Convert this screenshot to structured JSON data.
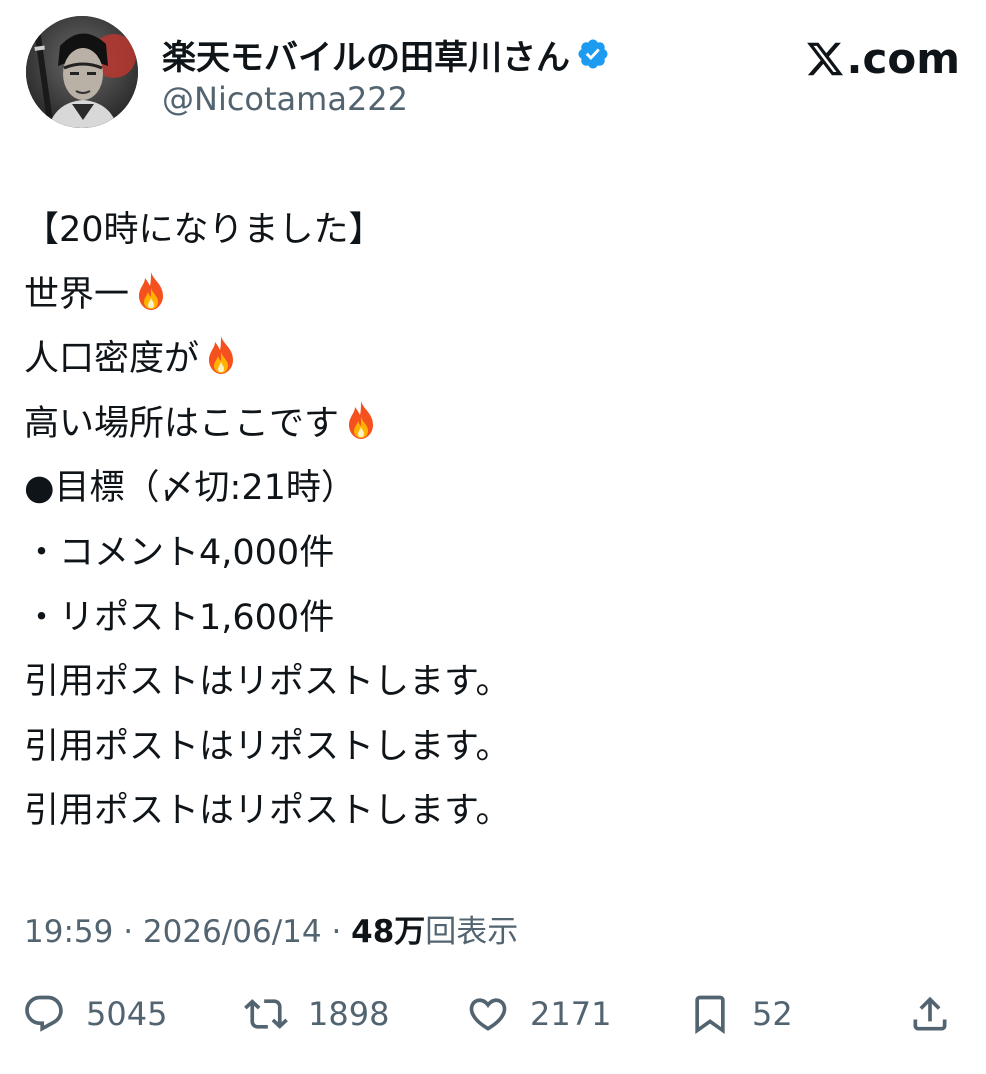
{
  "header": {
    "display_name": "楽天モバイルの田草川さん",
    "handle": "@Nicotama222",
    "brand": ".com",
    "verified_color": "#1d9bf0"
  },
  "tweet": {
    "lines": [
      {
        "text": "【20時になりました】",
        "flame": false
      },
      {
        "text": "世界一",
        "flame": true
      },
      {
        "text": "人口密度が",
        "flame": true
      },
      {
        "text": "高い場所はここです",
        "flame": true
      },
      {
        "text": "●目標（〆切:21時）",
        "flame": false
      },
      {
        "text": "・コメント4,000件",
        "flame": false
      },
      {
        "text": "・リポスト1,600件",
        "flame": false
      },
      {
        "text": "引用ポストはリポストします。",
        "flame": false
      },
      {
        "text": "引用ポストはリポストします。",
        "flame": false
      },
      {
        "text": "引用ポストはリポストします。",
        "flame": false
      }
    ]
  },
  "meta": {
    "time": "19:59",
    "separator": " · ",
    "date": "2026/06/14",
    "views_count": "48万",
    "views_label": "回表示"
  },
  "actions": {
    "reply_count": "5045",
    "repost_count": "1898",
    "like_count": "2171",
    "bookmark_count": "52"
  },
  "icons": {
    "reply": "speech-bubble-icon",
    "repost": "repost-arrows-icon",
    "like": "heart-icon",
    "bookmark": "bookmark-icon",
    "share": "share-upload-icon",
    "emoji": "fire-emoji"
  }
}
